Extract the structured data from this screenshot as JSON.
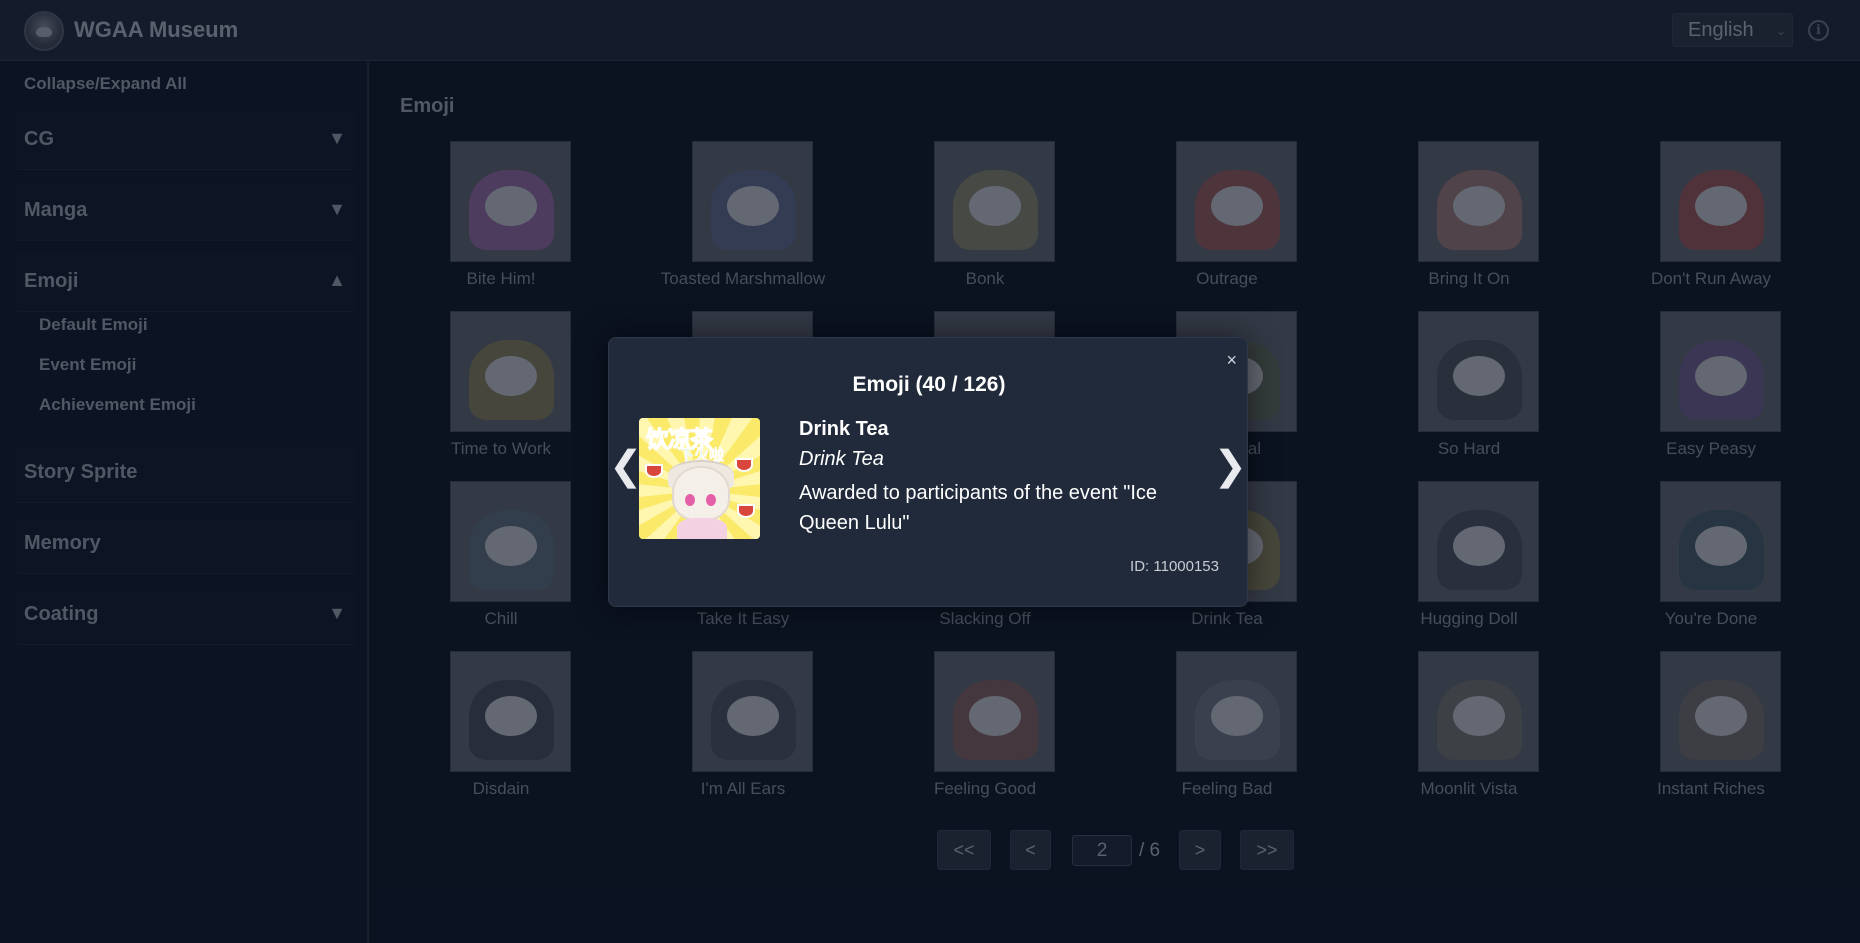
{
  "header": {
    "app_title": "WGAA Museum",
    "language": "English"
  },
  "sidebar": {
    "collapse_all": "Collapse/Expand All",
    "sections": [
      {
        "label": "CG",
        "arrow": "▼"
      },
      {
        "label": "Manga",
        "arrow": "▼"
      },
      {
        "label": "Emoji",
        "arrow": "▲"
      },
      {
        "label": "Story Sprite",
        "arrow": ""
      },
      {
        "label": "Memory",
        "arrow": ""
      },
      {
        "label": "Coating",
        "arrow": "▼"
      }
    ],
    "emoji_sub": [
      "Default Emoji",
      "Event Emoji",
      "Achievement Emoji"
    ]
  },
  "main": {
    "title": "Emoji",
    "items": [
      {
        "label": "Bite Him!",
        "color": "#7a5a8a"
      },
      {
        "label": "Toasted Marshmallow",
        "color": "#4f5a78"
      },
      {
        "label": "Bonk",
        "color": "#6c6f60"
      },
      {
        "label": "Outrage",
        "color": "#7a4d52"
      },
      {
        "label": "Bring It On",
        "color": "#7c6468"
      },
      {
        "label": "Don't Run Away",
        "color": "#7d4a50"
      },
      {
        "label": "Time to Work",
        "color": "#6d6a55"
      },
      {
        "label": "",
        "color": "#6e5858"
      },
      {
        "label": "",
        "color": "#5c4f6d"
      },
      {
        "label": "t Festival",
        "color": "#4f5a52"
      },
      {
        "label": "So Hard",
        "color": "#3e4552"
      },
      {
        "label": "Easy Peasy",
        "color": "#5a4f78"
      },
      {
        "label": "Chill",
        "color": "#4c5c6d"
      },
      {
        "label": "Take It Easy",
        "color": "#585e6a"
      },
      {
        "label": "Slacking Off",
        "color": "#585e6a"
      },
      {
        "label": "Drink Tea",
        "color": "#6e6a52"
      },
      {
        "label": "Hugging Doll",
        "color": "#3f4555"
      },
      {
        "label": "You're Done",
        "color": "#3a4c5c"
      },
      {
        "label": "Disdain",
        "color": "#3c4252"
      },
      {
        "label": "I'm All Ears",
        "color": "#404656"
      },
      {
        "label": "Feeling Good",
        "color": "#6a5254"
      },
      {
        "label": "Feeling Bad",
        "color": "#5a6070"
      },
      {
        "label": "Moonlit Vista",
        "color": "#5e5f62"
      },
      {
        "label": "Instant Riches",
        "color": "#5c5c60"
      }
    ]
  },
  "pagination": {
    "first": "<<",
    "prev": "<",
    "current": "2",
    "total": "/ 6",
    "next": ">",
    "last": ">>"
  },
  "modal": {
    "title": "Emoji (40 / 126)",
    "close": "×",
    "prev": "❮",
    "next": "❯",
    "image_text_1": "饮凉茶",
    "image_text_2": "下火啦",
    "name": "Drink Tea",
    "subtitle": "Drink Tea",
    "description": "Awarded to participants of the event \"Ice Queen Lulu\"",
    "id": "ID: 11000153"
  }
}
